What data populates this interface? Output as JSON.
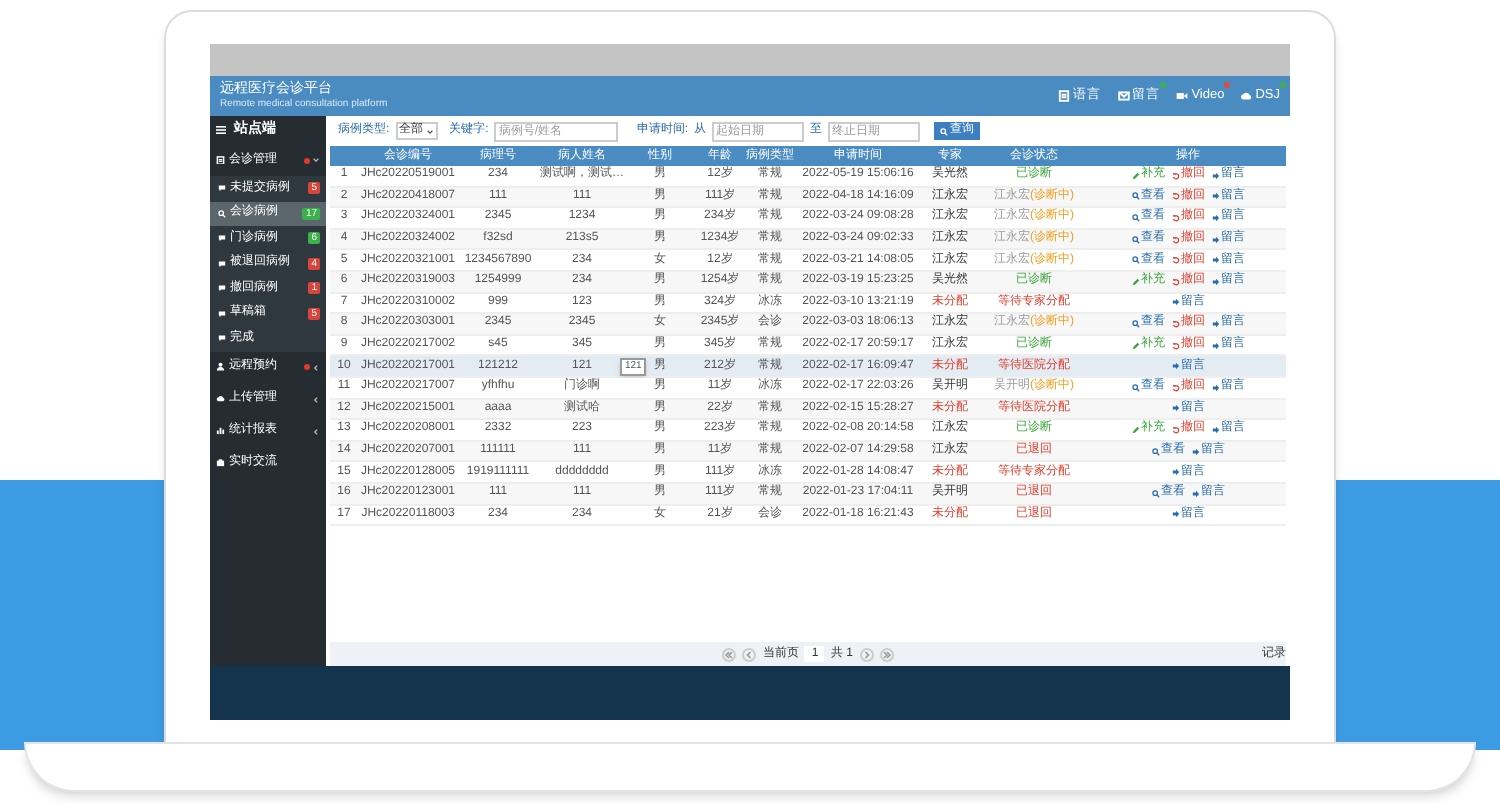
{
  "header": {
    "title": "远程医疗会诊平台",
    "subtitle": "Remote medical consultation platform",
    "links": [
      {
        "kind": "language",
        "label": "语言"
      },
      {
        "kind": "message",
        "label": "留言",
        "color": "#3cb04a"
      },
      {
        "kind": "video",
        "label": "Video",
        "color": "#e04b3a"
      },
      {
        "kind": "cloud",
        "label": "DSJ",
        "color": "#3cb04a"
      }
    ]
  },
  "sidebar": {
    "title": "站点端",
    "items": [
      {
        "label": "会诊管理",
        "kind": "group",
        "dot": true,
        "expanded": true,
        "children": [
          {
            "label": "未提交病例",
            "count": "5",
            "color": "#d9453b",
            "selected": false
          },
          {
            "label": "会诊病例",
            "count": "17",
            "color": "#3cb04a",
            "selected": true
          },
          {
            "label": "门诊病例",
            "count": "6",
            "color": "#3cb04a",
            "selected": false
          },
          {
            "label": "被退回病例",
            "count": "4",
            "color": "#d9453b",
            "selected": false
          },
          {
            "label": "撤回病例",
            "count": "1",
            "color": "#d9453b",
            "selected": false
          },
          {
            "label": "草稿箱",
            "count": "5",
            "color": "#d9453b",
            "selected": false
          },
          {
            "label": "完成",
            "selected": false
          }
        ]
      },
      {
        "label": "远程预约",
        "kind": "group",
        "dot": true,
        "expanded": false
      },
      {
        "label": "上传管理",
        "kind": "group",
        "dot": false,
        "expanded": false
      },
      {
        "label": "统计报表",
        "kind": "group",
        "dot": false,
        "expanded": false
      },
      {
        "label": "实时交流",
        "kind": "link"
      }
    ]
  },
  "filters": {
    "type_label": "病例类型:",
    "type_value": "全部",
    "keyword_label": "关键字:",
    "keyword_placeholder": "病例号/姓名",
    "date_label": "申请时间:",
    "from": "从",
    "from_placeholder": "起始日期",
    "to": "至",
    "to_placeholder": "终止日期",
    "search": "查询"
  },
  "table": {
    "columns": [
      "",
      "会诊编号",
      "病理号",
      "病人姓名",
      "性别",
      "年龄",
      "病例类型",
      "申请时间",
      "专家",
      "会诊状态",
      "操作"
    ],
    "rows": [
      {
        "cells": [
          "1",
          "JHc20220519001",
          "234",
          "测试啊，测试…",
          "男",
          "12岁",
          "常规",
          "2022-05-19 15:06:16"
        ],
        "expert": "吴光然",
        "assigned": true,
        "status": {
          "kind": "done",
          "text": "已诊断"
        },
        "actions": [
          {
            "kind": "edit",
            "label": "补充"
          },
          {
            "kind": "withdraw",
            "label": "撤回"
          },
          {
            "kind": "message",
            "label": "留言"
          }
        ],
        "highlighted": false
      },
      {
        "cells": [
          "2",
          "JHc20220418007",
          "111",
          "111",
          "男",
          "111岁",
          "常规",
          "2022-04-18 14:16:09"
        ],
        "expert": "江永宏",
        "assigned": true,
        "status": {
          "kind": "diagnosing",
          "prefix": "江永宏",
          "text": "(诊断中)"
        },
        "actions": [
          {
            "kind": "view",
            "label": "查看"
          },
          {
            "kind": "withdraw",
            "label": "撤回"
          },
          {
            "kind": "message",
            "label": "留言"
          }
        ],
        "highlighted": false
      },
      {
        "cells": [
          "3",
          "JHc20220324001",
          "2345",
          "1234",
          "男",
          "234岁",
          "常规",
          "2022-03-24 09:08:28"
        ],
        "expert": "江永宏",
        "assigned": true,
        "status": {
          "kind": "diagnosing",
          "prefix": "江永宏",
          "text": "(诊断中)"
        },
        "actions": [
          {
            "kind": "view",
            "label": "查看"
          },
          {
            "kind": "withdraw",
            "label": "撤回"
          },
          {
            "kind": "message",
            "label": "留言"
          }
        ],
        "highlighted": false
      },
      {
        "cells": [
          "4",
          "JHc20220324002",
          "f32sd",
          "213s5",
          "男",
          "1234岁",
          "常规",
          "2022-03-24 09:02:33"
        ],
        "expert": "江永宏",
        "assigned": true,
        "status": {
          "kind": "diagnosing",
          "prefix": "江永宏",
          "text": "(诊断中)"
        },
        "actions": [
          {
            "kind": "view",
            "label": "查看"
          },
          {
            "kind": "withdraw",
            "label": "撤回"
          },
          {
            "kind": "message",
            "label": "留言"
          }
        ],
        "highlighted": false
      },
      {
        "cells": [
          "5",
          "JHc20220321001",
          "1234567890",
          "234",
          "女",
          "12岁",
          "常规",
          "2022-03-21 14:08:05"
        ],
        "expert": "江永宏",
        "assigned": true,
        "status": {
          "kind": "diagnosing",
          "prefix": "江永宏",
          "text": "(诊断中)"
        },
        "actions": [
          {
            "kind": "view",
            "label": "查看"
          },
          {
            "kind": "withdraw",
            "label": "撤回"
          },
          {
            "kind": "message",
            "label": "留言"
          }
        ],
        "highlighted": false
      },
      {
        "cells": [
          "6",
          "JHc20220319003",
          "1254999",
          "234",
          "男",
          "1254岁",
          "常规",
          "2022-03-19 15:23:25"
        ],
        "expert": "吴光然",
        "assigned": true,
        "status": {
          "kind": "done",
          "text": "已诊断"
        },
        "actions": [
          {
            "kind": "edit",
            "label": "补充"
          },
          {
            "kind": "withdraw",
            "label": "撤回"
          },
          {
            "kind": "message",
            "label": "留言"
          }
        ],
        "highlighted": false
      },
      {
        "cells": [
          "7",
          "JHc20220310002",
          "999",
          "123",
          "男",
          "324岁",
          "冰冻",
          "2022-03-10 13:21:19"
        ],
        "expert": "未分配",
        "assigned": false,
        "status": {
          "kind": "waiting",
          "text": "等待专家分配"
        },
        "actions": [
          {
            "kind": "message",
            "label": "留言"
          }
        ],
        "highlighted": false
      },
      {
        "cells": [
          "8",
          "JHc20220303001",
          "2345",
          "2345",
          "女",
          "2345岁",
          "会诊",
          "2022-03-03 18:06:13"
        ],
        "expert": "江永宏",
        "assigned": true,
        "status": {
          "kind": "diagnosing",
          "prefix": "江永宏",
          "text": "(诊断中)"
        },
        "actions": [
          {
            "kind": "view",
            "label": "查看"
          },
          {
            "kind": "withdraw",
            "label": "撤回"
          },
          {
            "kind": "message",
            "label": "留言"
          }
        ],
        "highlighted": false
      },
      {
        "cells": [
          "9",
          "JHc20220217002",
          "s45",
          "345",
          "男",
          "345岁",
          "常规",
          "2022-02-17 20:59:17"
        ],
        "expert": "江永宏",
        "assigned": true,
        "status": {
          "kind": "done",
          "text": "已诊断"
        },
        "actions": [
          {
            "kind": "edit",
            "label": "补充"
          },
          {
            "kind": "withdraw",
            "label": "撤回"
          },
          {
            "kind": "message",
            "label": "留言"
          }
        ],
        "highlighted": false
      },
      {
        "cells": [
          "10",
          "JHc20220217001",
          "121212",
          "121",
          "男",
          "212岁",
          "常规",
          "2022-02-17 16:09:47"
        ],
        "expert": "未分配",
        "assigned": false,
        "status": {
          "kind": "waiting",
          "text": "等待医院分配"
        },
        "actions": [
          {
            "kind": "message",
            "label": "留言"
          }
        ],
        "highlighted": true,
        "tooltip": "121"
      },
      {
        "cells": [
          "11",
          "JHc20220217007",
          "yfhfhu",
          "门诊啊",
          "男",
          "11岁",
          "冰冻",
          "2022-02-17 22:03:26"
        ],
        "expert": "吴开明",
        "assigned": true,
        "status": {
          "kind": "diagnosing",
          "prefix": "吴开明",
          "text": "(诊断中)"
        },
        "actions": [
          {
            "kind": "view",
            "label": "查看"
          },
          {
            "kind": "withdraw",
            "label": "撤回"
          },
          {
            "kind": "message",
            "label": "留言"
          }
        ],
        "highlighted": false
      },
      {
        "cells": [
          "12",
          "JHc20220215001",
          "aaaa",
          "测试哈",
          "男",
          "22岁",
          "常规",
          "2022-02-15 15:28:27"
        ],
        "expert": "未分配",
        "assigned": false,
        "status": {
          "kind": "waiting",
          "text": "等待医院分配"
        },
        "actions": [
          {
            "kind": "message",
            "label": "留言"
          }
        ],
        "highlighted": false
      },
      {
        "cells": [
          "13",
          "JHc20220208001",
          "2332",
          "223",
          "男",
          "223岁",
          "常规",
          "2022-02-08 20:14:58"
        ],
        "expert": "江永宏",
        "assigned": true,
        "status": {
          "kind": "done",
          "text": "已诊断"
        },
        "actions": [
          {
            "kind": "edit",
            "label": "补充"
          },
          {
            "kind": "withdraw",
            "label": "撤回"
          },
          {
            "kind": "message",
            "label": "留言"
          }
        ],
        "highlighted": false
      },
      {
        "cells": [
          "14",
          "JHc20220207001",
          "111111",
          "111",
          "男",
          "11岁",
          "常规",
          "2022-02-07 14:29:58"
        ],
        "expert": "江永宏",
        "assigned": true,
        "status": {
          "kind": "returned",
          "text": "已退回"
        },
        "actions": [
          {
            "kind": "view",
            "label": "查看"
          },
          {
            "kind": "message",
            "label": "留言"
          }
        ],
        "highlighted": false
      },
      {
        "cells": [
          "15",
          "JHc20220128005",
          "1919111111",
          "dddddddd",
          "男",
          "111岁",
          "冰冻",
          "2022-01-28 14:08:47"
        ],
        "expert": "未分配",
        "assigned": false,
        "status": {
          "kind": "waiting",
          "text": "等待专家分配"
        },
        "actions": [
          {
            "kind": "message",
            "label": "留言"
          }
        ],
        "highlighted": false
      },
      {
        "cells": [
          "16",
          "JHc20220123001",
          "111",
          "111",
          "男",
          "111岁",
          "常规",
          "2022-01-23 17:04:11"
        ],
        "expert": "吴开明",
        "assigned": true,
        "status": {
          "kind": "returned",
          "text": "已退回"
        },
        "actions": [
          {
            "kind": "view",
            "label": "查看"
          },
          {
            "kind": "message",
            "label": "留言"
          }
        ],
        "highlighted": false
      },
      {
        "cells": [
          "17",
          "JHc20220118003",
          "234",
          "234",
          "女",
          "21岁",
          "会诊",
          "2022-01-18 16:21:43"
        ],
        "expert": "未分配",
        "assigned": false,
        "status": {
          "kind": "returned",
          "text": "已退回"
        },
        "actions": [
          {
            "kind": "message",
            "label": "留言"
          }
        ],
        "highlighted": false
      }
    ]
  },
  "pager": {
    "label": "当前页",
    "page": "1",
    "total": "共 1",
    "records": "记录"
  }
}
